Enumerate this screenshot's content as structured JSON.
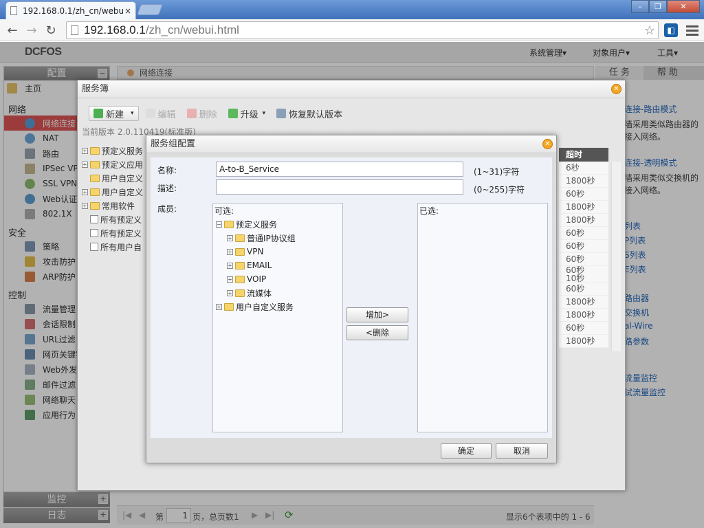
{
  "browser": {
    "tab_title": "192.168.0.1/zh_cn/webu",
    "tab_close": "×",
    "url_host": "192.168.0.1",
    "url_path": "/zh_cn/webui.html",
    "window_buttons": [
      "–",
      "❐",
      "✕"
    ],
    "nav_icons": [
      "←",
      "→",
      "↻"
    ],
    "star": "☆"
  },
  "app": {
    "logo": "DCFOS",
    "top_menu": [
      "系统管理▾",
      "对象用户▾",
      "工具▾"
    ]
  },
  "left": {
    "config_header": "配置",
    "collapse": "−",
    "home": "主页",
    "sections": [
      {
        "title": "网络",
        "items": [
          "网络连接",
          "NAT",
          "路由",
          "IPSec VPN",
          "SSL VPN",
          "Web认证",
          "802.1X"
        ]
      },
      {
        "title": "安全",
        "items": [
          "策略",
          "攻击防护",
          "ARP防护"
        ]
      },
      {
        "title": "控制",
        "items": [
          "流量管理",
          "会话限制",
          "URL过滤",
          "网页关键字",
          "Web外发",
          "邮件过滤",
          "网络聊天",
          "应用行为"
        ]
      }
    ],
    "footer": [
      "监控",
      "日志"
    ],
    "expand": "+"
  },
  "main": {
    "breadcrumb": "网络连接",
    "pager": {
      "first": "|◀",
      "prev": "◀",
      "page_prefix": "第",
      "page_value": "1",
      "page_suffix": "页，总页数1",
      "next": "▶",
      "last": "▶|",
      "refresh": "⟳",
      "summary": "显示6个表项中的 1 - 6"
    }
  },
  "right": {
    "tabs": [
      "任 务",
      "帮 助"
    ],
    "links": [
      "连接-路由模式",
      "连接-透明模式",
      "列表",
      "P列表",
      "S列表",
      "E列表",
      "路由器",
      "交换机",
      "al-Wire",
      "路参数",
      "流量监控",
      "试流量监控"
    ],
    "texts": [
      "墙采用类似路由器的",
      "接入网络。",
      "墙采用类似交换机的",
      "接入网络。"
    ]
  },
  "dlg1": {
    "title": "服务簿",
    "close": "✕",
    "toolbar": {
      "new": "新建",
      "edit": "编辑",
      "delete": "删除",
      "upgrade": "升级",
      "restore": "恢复默认版本"
    },
    "version": "当前版本 2.0.110419(标准版)",
    "tree": [
      "预定义服务",
      "预定义应用",
      "用户自定义",
      "用户自定义",
      "常用软件",
      "所有预定义",
      "所有预定义",
      "所有用户自"
    ],
    "timeout_header": "超时",
    "timeouts": [
      "6秒",
      "1800秒",
      "60秒",
      "1800秒",
      "1800秒",
      "60秒",
      "60秒",
      "60秒",
      "60秒",
      "10秒",
      "60秒",
      "1800秒",
      "1800秒",
      "60秒",
      "1800秒"
    ]
  },
  "dlg2": {
    "title": "服务组配置",
    "close": "✕",
    "name_label": "名称:",
    "name_value": "A-to-B_Service",
    "name_hint": "(1~31)字符",
    "desc_label": "描述:",
    "desc_value": "",
    "desc_hint": "(0~255)字符",
    "member_label": "成员:",
    "available_title": "可选:",
    "selected_title": "已选:",
    "tree_root": "预定义服务",
    "tree_children": [
      "普通IP协议组",
      "VPN",
      "EMAIL",
      "VOIP",
      "流媒体"
    ],
    "tree_root2": "用户自定义服务",
    "add": "增加>",
    "remove": "<删除",
    "ok": "确定",
    "cancel": "取消"
  }
}
